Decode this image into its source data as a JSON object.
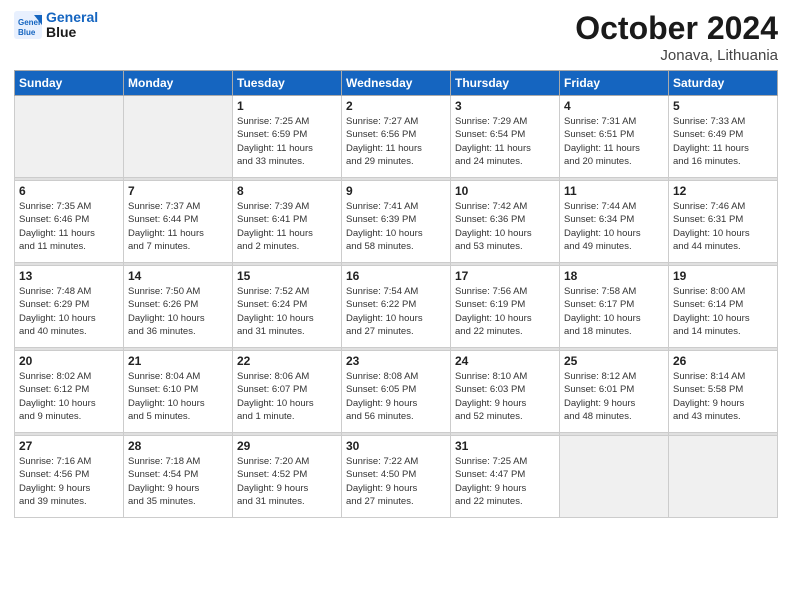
{
  "header": {
    "logo_line1": "General",
    "logo_line2": "Blue",
    "month": "October 2024",
    "location": "Jonava, Lithuania"
  },
  "weekdays": [
    "Sunday",
    "Monday",
    "Tuesday",
    "Wednesday",
    "Thursday",
    "Friday",
    "Saturday"
  ],
  "weeks": [
    [
      {
        "day": "",
        "info": ""
      },
      {
        "day": "",
        "info": ""
      },
      {
        "day": "1",
        "info": "Sunrise: 7:25 AM\nSunset: 6:59 PM\nDaylight: 11 hours\nand 33 minutes."
      },
      {
        "day": "2",
        "info": "Sunrise: 7:27 AM\nSunset: 6:56 PM\nDaylight: 11 hours\nand 29 minutes."
      },
      {
        "day": "3",
        "info": "Sunrise: 7:29 AM\nSunset: 6:54 PM\nDaylight: 11 hours\nand 24 minutes."
      },
      {
        "day": "4",
        "info": "Sunrise: 7:31 AM\nSunset: 6:51 PM\nDaylight: 11 hours\nand 20 minutes."
      },
      {
        "day": "5",
        "info": "Sunrise: 7:33 AM\nSunset: 6:49 PM\nDaylight: 11 hours\nand 16 minutes."
      }
    ],
    [
      {
        "day": "6",
        "info": "Sunrise: 7:35 AM\nSunset: 6:46 PM\nDaylight: 11 hours\nand 11 minutes."
      },
      {
        "day": "7",
        "info": "Sunrise: 7:37 AM\nSunset: 6:44 PM\nDaylight: 11 hours\nand 7 minutes."
      },
      {
        "day": "8",
        "info": "Sunrise: 7:39 AM\nSunset: 6:41 PM\nDaylight: 11 hours\nand 2 minutes."
      },
      {
        "day": "9",
        "info": "Sunrise: 7:41 AM\nSunset: 6:39 PM\nDaylight: 10 hours\nand 58 minutes."
      },
      {
        "day": "10",
        "info": "Sunrise: 7:42 AM\nSunset: 6:36 PM\nDaylight: 10 hours\nand 53 minutes."
      },
      {
        "day": "11",
        "info": "Sunrise: 7:44 AM\nSunset: 6:34 PM\nDaylight: 10 hours\nand 49 minutes."
      },
      {
        "day": "12",
        "info": "Sunrise: 7:46 AM\nSunset: 6:31 PM\nDaylight: 10 hours\nand 44 minutes."
      }
    ],
    [
      {
        "day": "13",
        "info": "Sunrise: 7:48 AM\nSunset: 6:29 PM\nDaylight: 10 hours\nand 40 minutes."
      },
      {
        "day": "14",
        "info": "Sunrise: 7:50 AM\nSunset: 6:26 PM\nDaylight: 10 hours\nand 36 minutes."
      },
      {
        "day": "15",
        "info": "Sunrise: 7:52 AM\nSunset: 6:24 PM\nDaylight: 10 hours\nand 31 minutes."
      },
      {
        "day": "16",
        "info": "Sunrise: 7:54 AM\nSunset: 6:22 PM\nDaylight: 10 hours\nand 27 minutes."
      },
      {
        "day": "17",
        "info": "Sunrise: 7:56 AM\nSunset: 6:19 PM\nDaylight: 10 hours\nand 22 minutes."
      },
      {
        "day": "18",
        "info": "Sunrise: 7:58 AM\nSunset: 6:17 PM\nDaylight: 10 hours\nand 18 minutes."
      },
      {
        "day": "19",
        "info": "Sunrise: 8:00 AM\nSunset: 6:14 PM\nDaylight: 10 hours\nand 14 minutes."
      }
    ],
    [
      {
        "day": "20",
        "info": "Sunrise: 8:02 AM\nSunset: 6:12 PM\nDaylight: 10 hours\nand 9 minutes."
      },
      {
        "day": "21",
        "info": "Sunrise: 8:04 AM\nSunset: 6:10 PM\nDaylight: 10 hours\nand 5 minutes."
      },
      {
        "day": "22",
        "info": "Sunrise: 8:06 AM\nSunset: 6:07 PM\nDaylight: 10 hours\nand 1 minute."
      },
      {
        "day": "23",
        "info": "Sunrise: 8:08 AM\nSunset: 6:05 PM\nDaylight: 9 hours\nand 56 minutes."
      },
      {
        "day": "24",
        "info": "Sunrise: 8:10 AM\nSunset: 6:03 PM\nDaylight: 9 hours\nand 52 minutes."
      },
      {
        "day": "25",
        "info": "Sunrise: 8:12 AM\nSunset: 6:01 PM\nDaylight: 9 hours\nand 48 minutes."
      },
      {
        "day": "26",
        "info": "Sunrise: 8:14 AM\nSunset: 5:58 PM\nDaylight: 9 hours\nand 43 minutes."
      }
    ],
    [
      {
        "day": "27",
        "info": "Sunrise: 7:16 AM\nSunset: 4:56 PM\nDaylight: 9 hours\nand 39 minutes."
      },
      {
        "day": "28",
        "info": "Sunrise: 7:18 AM\nSunset: 4:54 PM\nDaylight: 9 hours\nand 35 minutes."
      },
      {
        "day": "29",
        "info": "Sunrise: 7:20 AM\nSunset: 4:52 PM\nDaylight: 9 hours\nand 31 minutes."
      },
      {
        "day": "30",
        "info": "Sunrise: 7:22 AM\nSunset: 4:50 PM\nDaylight: 9 hours\nand 27 minutes."
      },
      {
        "day": "31",
        "info": "Sunrise: 7:25 AM\nSunset: 4:47 PM\nDaylight: 9 hours\nand 22 minutes."
      },
      {
        "day": "",
        "info": ""
      },
      {
        "day": "",
        "info": ""
      }
    ]
  ]
}
